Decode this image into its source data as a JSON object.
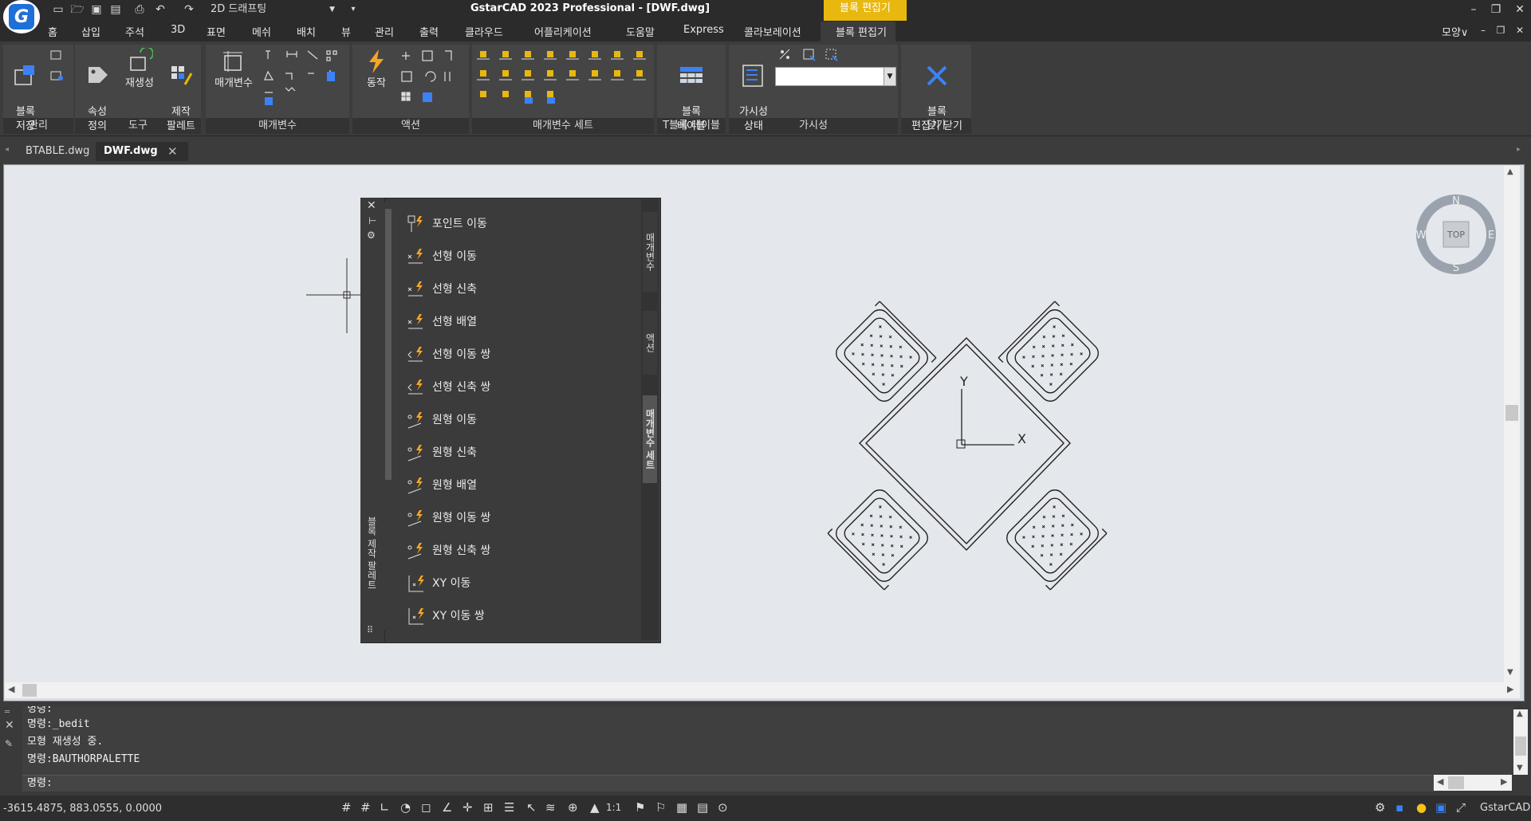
{
  "title_bar": {
    "workspace": "2D 드래프팅",
    "title": "GstarCAD 2023 Professional - [DWF.dwg]",
    "context_label": "블록 편집기"
  },
  "menu_tabs": [
    "홈",
    "삽입",
    "주석",
    "3D",
    "표면",
    "메쉬",
    "배치",
    "뷰",
    "관리",
    "출력",
    "클라우드",
    "어플리케이션",
    "도움말",
    "Express",
    "콜라보레이션",
    "블록 편집기"
  ],
  "view_control": "모양∨",
  "ribbon": {
    "panels": [
      {
        "label": "관리",
        "buttons": [
          "블록\n저장"
        ]
      },
      {
        "label": "도구",
        "buttons": [
          "속성\n정의",
          "재생성",
          "제작\n팔레트"
        ]
      },
      {
        "label": "매개변수",
        "buttons": [
          "매개변수"
        ]
      },
      {
        "label": "액션",
        "buttons": [
          "동작"
        ]
      },
      {
        "label": "매개변수 세트",
        "buttons": []
      },
      {
        "label": "T블록 테이블",
        "buttons": [
          "블록\n테이블"
        ]
      },
      {
        "label": "가시성",
        "buttons": [
          "가시성\n상태"
        ]
      },
      {
        "label": "닫기",
        "buttons": [
          "블록\n편집기 닫기"
        ]
      }
    ],
    "save_block": "블록\n저장",
    "attr_def": "속성\n정의",
    "regen": "재생성",
    "authoring_palette": "제작\n팔레트",
    "parameter": "매개변수",
    "action": "동작",
    "block_table": "블록\n테이블",
    "vis_state": "가시성\n상태",
    "close_editor": "블록\n편집기 닫기",
    "panel_labels": {
      "manage": "관리",
      "tools": "도구",
      "params": "매개변수",
      "actions": "액션",
      "param_sets": "매개변수 세트",
      "tblock": "T블록 테이블",
      "visibility": "가시성",
      "close": "닫기"
    }
  },
  "doc_tabs": [
    "BTABLE.dwg",
    "DWF.dwg"
  ],
  "palette": {
    "side_title": "블록 제작 팔레트",
    "tabs": [
      "매개변수",
      "액션",
      "매개변수 세트"
    ],
    "items": [
      "포인트 이동",
      "선형 이동",
      "선형 신축",
      "선형 배열",
      "선형 이동 쌍",
      "선형 신축 쌍",
      "원형 이동",
      "원형 신축",
      "원형 배열",
      "원형 이동 쌍",
      "원형 신축 쌍",
      "XY 이동",
      "XY 이동 쌍"
    ]
  },
  "viewcube": {
    "top": "TOP",
    "n": "N",
    "s": "S",
    "e": "E",
    "w": "W"
  },
  "ucs": {
    "x": "X",
    "y": "Y"
  },
  "command": {
    "history": [
      "명령:",
      "명령:_bedit",
      "모형 재생성 중.",
      "명령:BAUTHORPALETTE"
    ],
    "prompt": "명령:"
  },
  "status": {
    "coords": "-3615.4875, 883.0555, 0.0000",
    "scale": "1:1",
    "app": "GstarCAD"
  },
  "colors": {
    "accent": "#e8b80f",
    "canvas": "#e4e7eb",
    "dark": "#2b2b2b"
  }
}
